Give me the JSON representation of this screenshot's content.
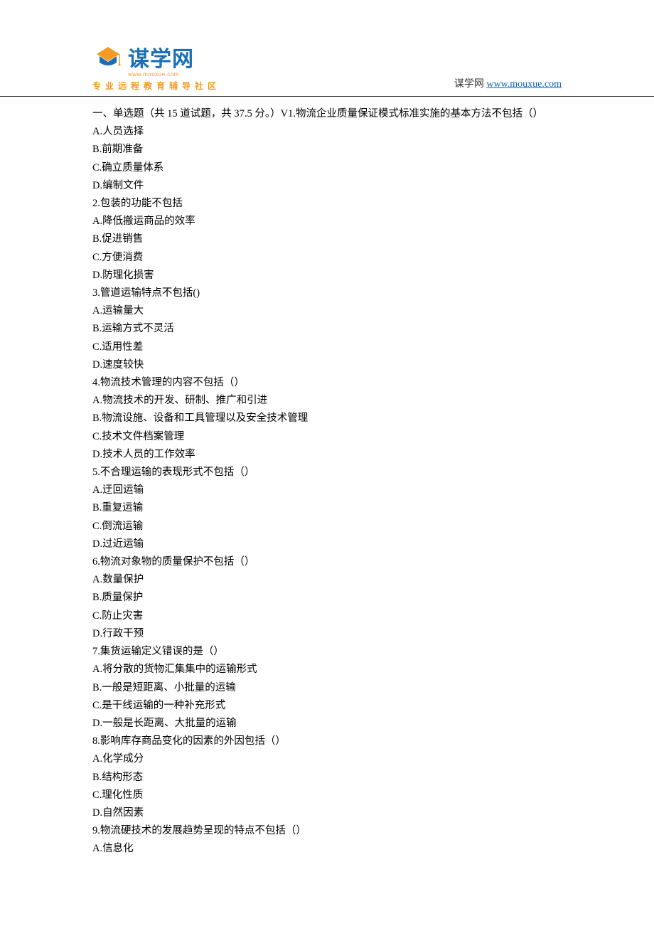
{
  "header": {
    "logo_text": "谋学网",
    "logo_url": "www.mouxue.com",
    "logo_subtitle": "专业远程教育辅导社区",
    "site_label": "谋学网",
    "site_link": "www.mouxue.com"
  },
  "section_header": "一、单选题（共 15 道试题，共 37.5 分。）V1.物流企业质量保证模式标准实施的基本方法不包括（）",
  "questions": [
    {
      "options": [
        "A.人员选择",
        "B.前期准备",
        "C.确立质量体系",
        "D.编制文件"
      ]
    },
    {
      "stem": "2.包装的功能不包括",
      "options": [
        "A.降低搬运商品的效率",
        "B.促进销售",
        "C.方便消费",
        "D.防理化损害"
      ]
    },
    {
      "stem": "3.管道运输特点不包括()",
      "options": [
        "A.运输量大",
        "B.运输方式不灵活",
        "C.适用性差",
        "D.速度较快"
      ]
    },
    {
      "stem": "4.物流技术管理的内容不包括（）",
      "options": [
        "A.物流技术的开发、研制、推广和引进",
        "B.物流设施、设备和工具管理以及安全技术管理",
        "C.技术文件档案管理",
        "D.技术人员的工作效率"
      ]
    },
    {
      "stem": "5.不合理运输的表现形式不包括（）",
      "options": [
        "A.迂回运输",
        "B.重复运输",
        "C.倒流运输",
        "D.过近运输"
      ]
    },
    {
      "stem": "6.物流对象物的质量保护不包括（）",
      "options": [
        "A.数量保护",
        "B.质量保护",
        "C.防止灾害",
        "D.行政干预"
      ]
    },
    {
      "stem": "7.集货运输定义错误的是（）",
      "options": [
        "A.将分散的货物汇集集中的运输形式",
        "B.一般是短距离、小批量的运输",
        "C.是干线运输的一种补充形式",
        "D.一般是长距离、大批量的运输"
      ]
    },
    {
      "stem": "8.影响库存商品变化的因素的外因包括（）",
      "options": [
        "A.化学成分",
        "B.结构形态",
        "C.理化性质",
        "D.自然因素"
      ]
    },
    {
      "stem": "9.物流硬技术的发展趋势呈现的特点不包括（）",
      "options": [
        "A.信息化"
      ]
    }
  ]
}
